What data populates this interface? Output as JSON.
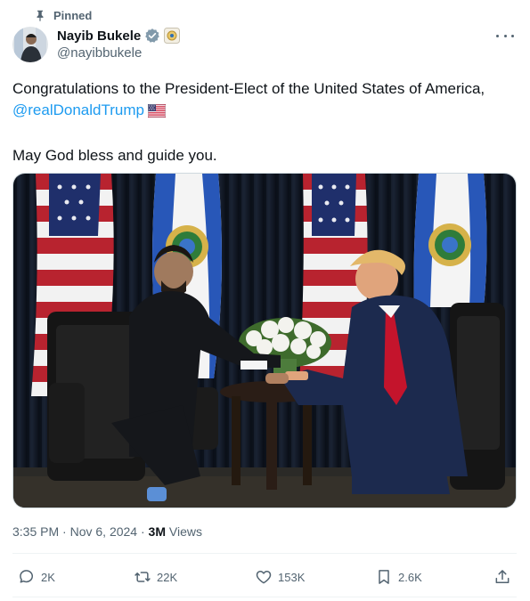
{
  "pinned_label": "Pinned",
  "author": {
    "display_name": "Nayib Bukele",
    "handle": "@nayibbukele",
    "verified_color": "#829aab"
  },
  "tweet": {
    "text_line1": "Congratulations to the President-Elect of the United States of America,",
    "mention": "@realDonaldTrump",
    "text_line2": "May God bless and guide you."
  },
  "meta": {
    "time": "3:35 PM",
    "separator": "·",
    "date": "Nov 6, 2024",
    "views_count": "3M",
    "views_label": "Views"
  },
  "actions": {
    "replies": "2K",
    "reposts": "22K",
    "likes": "153K",
    "bookmarks": "2.6K"
  },
  "colors": {
    "accent": "#1d9bf0",
    "muted": "#536471"
  }
}
